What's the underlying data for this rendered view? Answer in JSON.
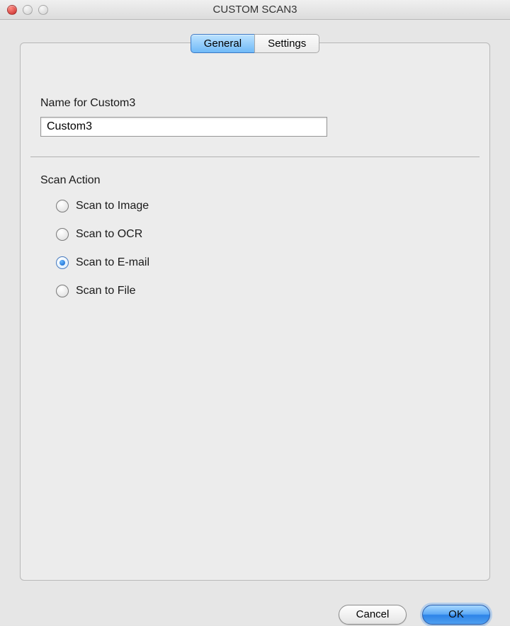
{
  "window": {
    "title": "CUSTOM SCAN3"
  },
  "tabs": {
    "general": "General",
    "settings": "Settings",
    "active": "general"
  },
  "form": {
    "name_label": "Name for Custom3",
    "name_value": "Custom3",
    "scan_action_label": "Scan Action",
    "options": {
      "image": "Scan to Image",
      "ocr": "Scan to OCR",
      "email": "Scan to E-mail",
      "file": "Scan to File"
    },
    "selected_option": "email"
  },
  "buttons": {
    "cancel": "Cancel",
    "ok": "OK"
  }
}
